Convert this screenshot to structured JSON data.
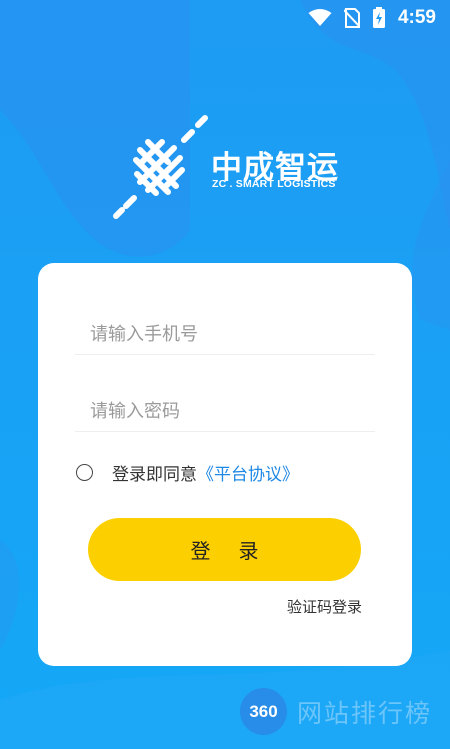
{
  "status_bar": {
    "time": "4:59",
    "icons": [
      "wifi-icon",
      "no-sim-icon",
      "battery-icon"
    ]
  },
  "logo": {
    "name_cn": "中成智运",
    "name_en": "ZC . SMART LOGISTICS"
  },
  "form": {
    "phone_placeholder": "请输入手机号",
    "password_placeholder": "请输入密码",
    "agree_prefix": "登录即同意",
    "agreement_link": "《平台协议》",
    "login_button": "登录",
    "sms_login_link": "验证码登录"
  },
  "watermark": {
    "badge": "360",
    "text": "网站排行榜"
  },
  "colors": {
    "background": "#1aa3f5",
    "accent_button": "#fcd000",
    "link": "#1e88e5",
    "card": "#ffffff"
  }
}
